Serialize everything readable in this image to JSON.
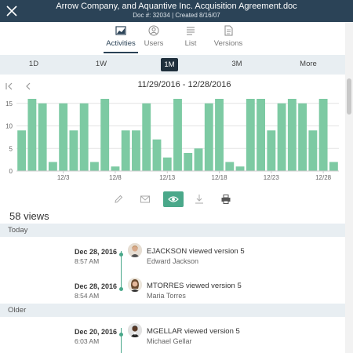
{
  "window": {
    "title": "Arrow Company, and Aquantive Inc. Acquisition Agreement.doc",
    "subtitle": "Doc #: 32034 | Created 8/16/07",
    "close_icon": "close-icon"
  },
  "tabs": [
    {
      "label": "Activities",
      "icon": "chart-icon",
      "active": true
    },
    {
      "label": "Users",
      "icon": "user-icon",
      "active": false
    },
    {
      "label": "List",
      "icon": "list-icon",
      "active": false
    },
    {
      "label": "Versions",
      "icon": "document-icon",
      "active": false
    }
  ],
  "ranges": [
    "1D",
    "1W",
    "1M",
    "3M",
    "More"
  ],
  "selected_range": "1M",
  "date_range": "11/29/2016 - 12/28/2016",
  "chart_data": {
    "type": "bar",
    "color": "#7dcaa3",
    "grid": true,
    "ylim": [
      0,
      16
    ],
    "yticks": [
      "0",
      "5",
      "10",
      "15"
    ],
    "xticks": [
      {
        "label": "12/3",
        "index": 4
      },
      {
        "label": "12/8",
        "index": 9
      },
      {
        "label": "12/13",
        "index": 14
      },
      {
        "label": "12/18",
        "index": 19
      },
      {
        "label": "12/23",
        "index": 24
      },
      {
        "label": "12/28",
        "index": 29
      }
    ],
    "values": [
      9,
      16,
      15,
      2,
      15,
      9,
      15,
      2,
      16,
      1,
      9,
      9,
      15,
      7,
      3,
      16,
      4,
      5,
      15,
      16,
      2,
      1,
      16,
      16,
      9,
      15,
      16,
      15,
      9,
      16,
      2
    ]
  },
  "toolbar": [
    "pencil-icon",
    "mail-icon",
    "eye-icon",
    "download-icon",
    "print-icon"
  ],
  "views_count": "58 views",
  "sections": [
    {
      "title": "Today",
      "items": [
        {
          "date": "Dec 28, 2016",
          "time": "8:57 AM",
          "action": "EJACKSON viewed version 5",
          "person": "Edward Jackson"
        },
        {
          "date": "Dec 28, 2016",
          "time": "8:54 AM",
          "action": "MTORRES viewed version 5",
          "person": "Maria Torres"
        }
      ]
    },
    {
      "title": "Older",
      "items": [
        {
          "date": "Dec 20, 2016",
          "time": "6:03 AM",
          "action": "MGELLAR viewed version 5",
          "person": "Michael Gellar"
        }
      ]
    }
  ],
  "colors": {
    "header": "#2b4357",
    "accent": "#4aa88a",
    "bar": "#7dcaa3",
    "band": "#e8eef2"
  }
}
